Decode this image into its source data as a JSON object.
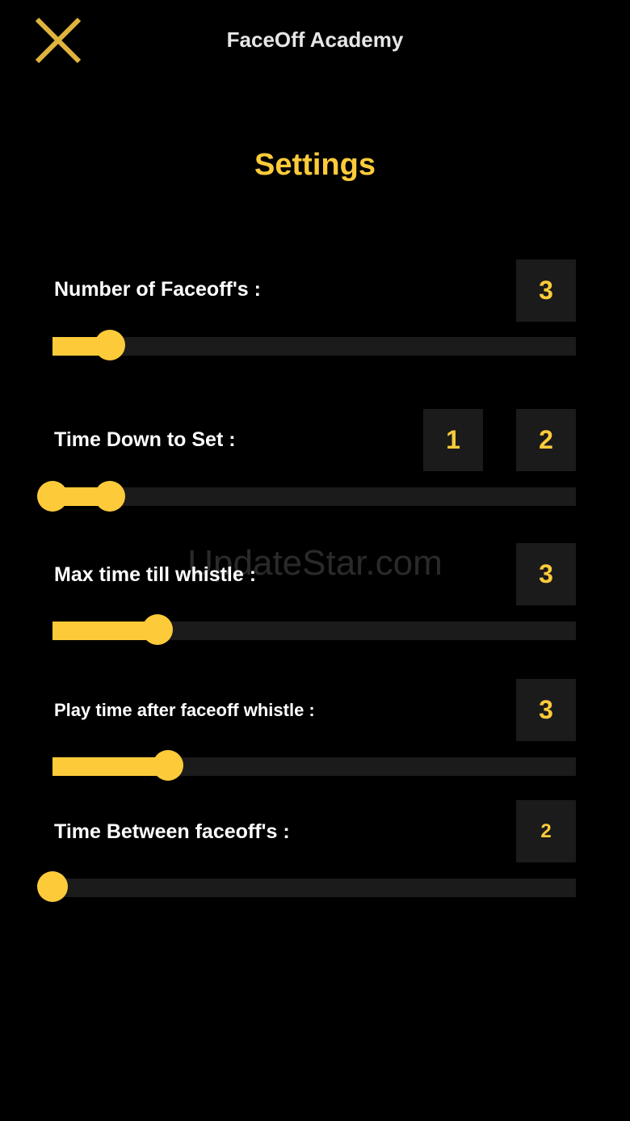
{
  "header": {
    "title": "FaceOff Academy",
    "close_icon": "close-icon"
  },
  "page": {
    "title": "Settings"
  },
  "colors": {
    "accent": "#FDCB3A",
    "background": "#000000",
    "box": "#1B1B1B",
    "track": "#1B1B1B"
  },
  "settings": [
    {
      "label": "Number of Faceoff's :",
      "values": [
        "3"
      ],
      "slider": {
        "type": "single",
        "level": 0.11
      }
    },
    {
      "label": "Time Down to Set :",
      "values": [
        "1",
        "2"
      ],
      "slider": {
        "type": "range",
        "low": 0,
        "high": 0.11
      }
    },
    {
      "label": "Max time till whistle :",
      "values": [
        "3"
      ],
      "slider": {
        "type": "single",
        "level": 0.2
      }
    },
    {
      "label": "Play time after faceoff whistle :",
      "values": [
        "3"
      ],
      "slider": {
        "type": "single",
        "level": 0.22
      }
    },
    {
      "label": "Time Between faceoff's :",
      "values": [
        "2"
      ],
      "slider": {
        "type": "single",
        "level": 0
      }
    }
  ],
  "watermark": "UpdateStar.com"
}
